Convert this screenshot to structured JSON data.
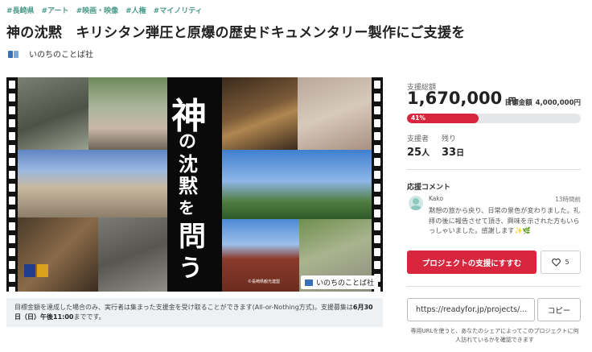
{
  "tags": [
    "#長崎県",
    "#アート",
    "#映画・映像",
    "#人権",
    "#マイノリティ"
  ],
  "title": "神の沈黙　キリシタン弾圧と原爆の歴史ドキュメンタリー製作にご支援を",
  "owner": {
    "name": "いのちのことば社"
  },
  "hero": {
    "big_char": "神",
    "small_chars": [
      "の",
      "沈",
      "黙",
      "を",
      "問",
      "う"
    ],
    "logo_text": "いのちのことば社",
    "caption": "©長崎県観光連盟"
  },
  "note": {
    "text": "目標金額を達成した場合のみ、実行者は集まった支援金を受け取ることができます(All-or-Nothing方式)。支援募集は",
    "deadline": "6月30日（日）午後11:00",
    "suffix": "までです。"
  },
  "funding": {
    "total_label": "支援総額",
    "amount": "1,670,000",
    "currency": "円",
    "goal_label": "目標金額",
    "goal_amount": "4,000,000円",
    "progress_percent": 41,
    "progress_text": "41%",
    "supporters_label": "支援者",
    "supporters_value": "25",
    "supporters_unit": "人",
    "remaining_label": "残り",
    "remaining_value": "33",
    "remaining_unit": "日"
  },
  "comments": {
    "heading": "応援コメント",
    "items": [
      {
        "name": "Kako",
        "time": "13時間前",
        "text": "黙想の旅から戻り、日常の景色が変わりました。礼拝の後に報告させて頂き、興味を示された方もいらっしゃいました。感謝します✨🌿"
      }
    ]
  },
  "actions": {
    "support_label": "プロジェクトの支援にすすむ",
    "favorite_count": "5",
    "share_url": "https://readyfor.jp/projects/...",
    "copy_label": "コピー",
    "url_note": "専用URLを使うと、あなたのシェアによってこのプロジェクトに何人訪れているかを確認できます"
  },
  "colors": {
    "accent": "#d7263d",
    "tag": "#4b9a8b"
  }
}
